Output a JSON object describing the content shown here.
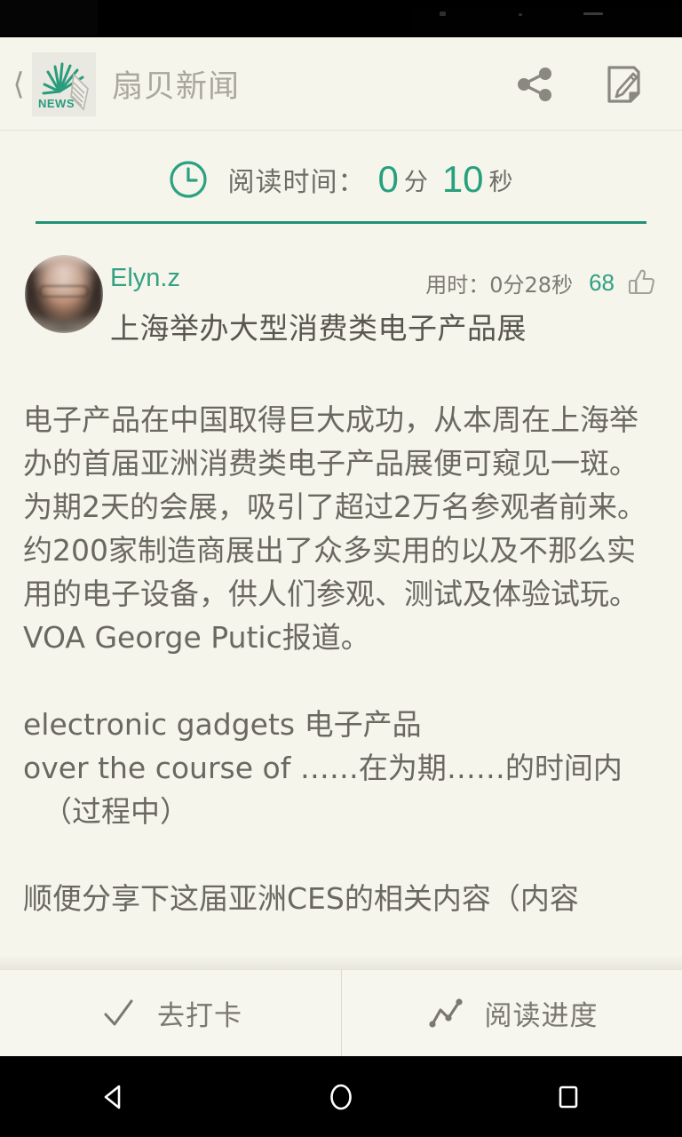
{
  "status_bar": {
    "background": "#000000"
  },
  "title_bar": {
    "back_icon": "back-chevron-icon",
    "logo_text": "NEWS",
    "app_title": "扇贝新闻",
    "share_icon": "share-icon",
    "note_icon": "note-edit-icon"
  },
  "reading_timer": {
    "clock_icon": "clock-icon",
    "label": "阅读时间：",
    "minutes": "0",
    "minutes_unit": "分",
    "seconds": "10",
    "seconds_unit": "秒",
    "accent_color": "#27a07e"
  },
  "note": {
    "avatar": "user-avatar",
    "author": "Elyn.z",
    "duration": "用时：0分28秒",
    "likes": "68",
    "like_icon": "thumbs-up-icon",
    "title": "上海举办大型消费类电子产品展",
    "paragraphs": [
      "电子产品在中国取得巨大成功，从本周在上海举办的首届亚洲消费类电子产品展便可窥见一斑。为期2天的会展，吸引了超过2万名参观者前来。约200家制造商展出了众多实用的以及不那么实用的电子设备，供人们参观、测试及体验试玩。VOA George Putic报道。"
    ],
    "vocab_line_1": "electronic gadgets 电子产品",
    "vocab_line_2": "over the course of ……在为期……的时间内",
    "vocab_line_3": "（过程中）",
    "closing_line": "顺便分享下这届亚洲CES的相关内容（内容"
  },
  "action_bar": {
    "check_in": {
      "icon": "check-icon",
      "label": "去打卡"
    },
    "progress": {
      "icon": "chart-line-icon",
      "label": "阅读进度"
    }
  },
  "nav_bar": {
    "back": "nav-back-triangle-icon",
    "home": "nav-home-circle-icon",
    "recents": "nav-recents-square-icon"
  },
  "theme": {
    "background": "#f6f5ec",
    "text": "#6a6861",
    "accent_green": "#27a07e",
    "rule_green": "#219177"
  }
}
